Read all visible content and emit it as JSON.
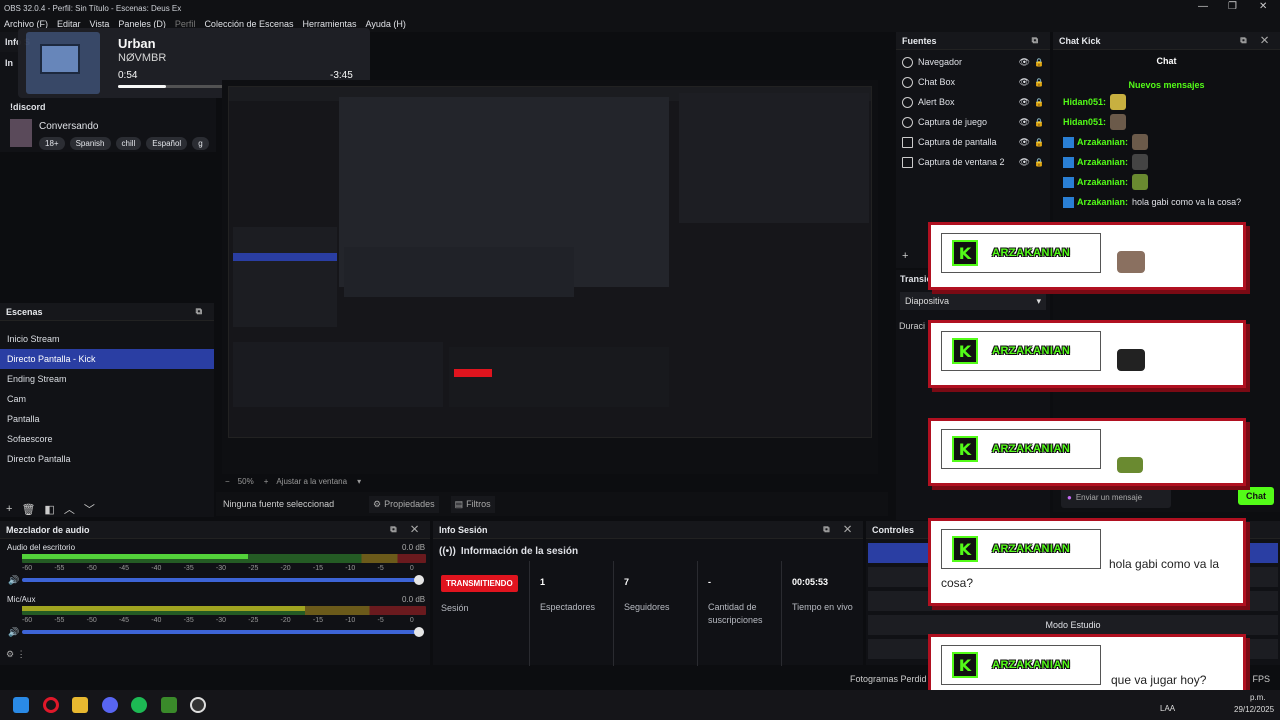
{
  "window": {
    "title": "OBS 32.0.4 - Perfil: Sin Título - Escenas: Deus Ex",
    "minimize_icon": "minimize-icon",
    "maximize_icon": "maximize-icon",
    "close_icon": "close-icon"
  },
  "menu": [
    {
      "label": "Archivo (F)",
      "enabled": true
    },
    {
      "label": "Editar",
      "enabled": true
    },
    {
      "label": "Vista",
      "enabled": true
    },
    {
      "label": "Paneles (D)",
      "enabled": true
    },
    {
      "label": "Perfil",
      "enabled": false
    },
    {
      "label": "Colección de Escenas",
      "enabled": true
    },
    {
      "label": "Herramientas",
      "enabled": true
    },
    {
      "label": "Ayuda (H)",
      "enabled": true
    }
  ],
  "media_player": {
    "track": "Urban",
    "artist": "NØVMBR",
    "elapsed": "0:54",
    "remaining": "-3:45",
    "progress": 0.2
  },
  "stream_info": {
    "header": "Info S",
    "sub": "In",
    "channel_prefix": "!discord",
    "category": "Conversando",
    "tags": [
      "18+",
      "Spanish",
      "chill",
      "Español",
      "g"
    ]
  },
  "scenes": {
    "header": "Escenas",
    "items": [
      {
        "label": "Inicio Stream",
        "selected": false
      },
      {
        "label": "Directo Pantalla - Kick",
        "selected": true
      },
      {
        "label": "Ending Stream",
        "selected": false
      },
      {
        "label": "Cam",
        "selected": false
      },
      {
        "label": "Pantalla",
        "selected": false
      },
      {
        "label": "Sofaescore",
        "selected": false
      },
      {
        "label": "Directo Pantalla",
        "selected": false
      }
    ]
  },
  "preview": {
    "zoom": "50%",
    "fit_label": "Ajustar a la ventana"
  },
  "source_toolbar": {
    "none_selected": "Ninguna fuente seleccionad",
    "properties": "Propiedades",
    "filters": "Filtros"
  },
  "mixer": {
    "header": "Mezclador de audio",
    "channels": [
      {
        "name": "Audio del escritorio",
        "db": "0.0 dB",
        "level": 0.56
      },
      {
        "name": "Mic/Aux",
        "db": "0.0 dB",
        "level": 0.7
      }
    ],
    "scale": [
      "-60",
      "-55",
      "-50",
      "-45",
      "-40",
      "-35",
      "-30",
      "-25",
      "-20",
      "-15",
      "-10",
      "-5",
      "0"
    ]
  },
  "info_session": {
    "header": "Info Sesión",
    "title": "Información de la sesión",
    "live_badge": "TRANSMITIENDO",
    "session_label": "Sesión",
    "stats": [
      {
        "value": "1",
        "label": "Espectadores"
      },
      {
        "value": "7",
        "label": "Seguidores"
      },
      {
        "value": "-",
        "label": "Cantidad de suscripciones"
      },
      {
        "value": "00:05:53",
        "label": "Tiempo en vivo"
      }
    ]
  },
  "sources": {
    "header": "Fuentes",
    "items": [
      {
        "label": "Navegador",
        "icon": "globe-icon"
      },
      {
        "label": "Chat Box",
        "icon": "globe-icon"
      },
      {
        "label": "Alert Box",
        "icon": "globe-icon"
      },
      {
        "label": "Captura de juego",
        "icon": "gamepad-icon"
      },
      {
        "label": "Captura de pantalla",
        "icon": "monitor-icon"
      },
      {
        "label": "Captura de ventana 2",
        "icon": "window-icon"
      }
    ]
  },
  "transitions": {
    "header": "Transicion",
    "selected": "Diapositiva",
    "duration_label": "Duraci"
  },
  "chat": {
    "header": "Chat Kick",
    "tab": "Chat",
    "new_messages": "Nuevos mensajes",
    "messages": [
      {
        "user": "Hidan051:",
        "text": "",
        "badge": false,
        "emote": true
      },
      {
        "user": "Hidan051:",
        "text": "",
        "badge": false,
        "emote": true
      },
      {
        "user": "Arzakanian:",
        "text": "",
        "badge": true,
        "emote": true
      },
      {
        "user": "Arzakanian:",
        "text": "",
        "badge": true,
        "emote": true
      },
      {
        "user": "Arzakanian:",
        "text": "",
        "badge": true,
        "emote": true
      },
      {
        "user": "Arzakanian:",
        "text": "hola gabi como va la cosa?",
        "badge": true,
        "emote": false
      }
    ],
    "send_placeholder": "Enviar un mensaje",
    "chat_button": "Chat"
  },
  "alerts": [
    {
      "user": "ARZAKANIAN",
      "message": ""
    },
    {
      "user": "ARZAKANIAN",
      "message": ""
    },
    {
      "user": "ARZAKANIAN",
      "message": ""
    },
    {
      "user": "ARZAKANIAN",
      "message": "hola gabi como va la cosa?"
    },
    {
      "user": "ARZAKANIAN",
      "message": "que va jugar hoy?"
    }
  ],
  "controls": {
    "header": "Controles",
    "studio_mode": "Modo Estudio",
    "frames_label": "Fotogramas Perdid",
    "fps": "0 FPS"
  },
  "taskbar": {
    "icons": [
      "windows-start-icon",
      "opera-icon",
      "folder-icon",
      "discord-icon",
      "spotify-icon",
      "minecraft-icon",
      "obs-icon"
    ],
    "lang": "LAA",
    "time_suffix": "p.m.",
    "date": "29/12/2025"
  },
  "colors": {
    "accent": "#2a3ea3",
    "kick_green": "#53fc18",
    "alert_red": "#b01020",
    "live_red": "#e0141e"
  }
}
